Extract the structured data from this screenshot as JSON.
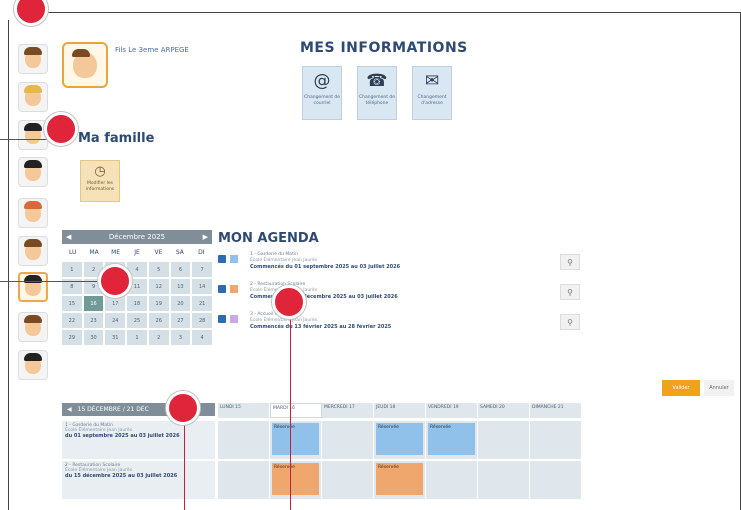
{
  "user": {
    "name": "Fils Le 3eme ARPEGE"
  },
  "mes_informations": {
    "title": "MES INFORMATIONS",
    "tiles": [
      {
        "icon": "at-icon",
        "label": "Changement de courriel"
      },
      {
        "icon": "phone-icon",
        "label": "Changement de téléphone"
      },
      {
        "icon": "envelope-icon",
        "label": "Changement d'adresse"
      }
    ]
  },
  "famille": {
    "title": "Ma famille",
    "tile_label": "Modifier les informations"
  },
  "calendar": {
    "month": "Décembre 2025",
    "days": [
      "LU",
      "MA",
      "ME",
      "JE",
      "VE",
      "SA",
      "DI"
    ],
    "cells": [
      "1",
      "2",
      "3",
      "4",
      "5",
      "6",
      "7",
      "8",
      "9",
      "10",
      "11",
      "12",
      "13",
      "14",
      "15",
      "16",
      "17",
      "18",
      "19",
      "20",
      "21",
      "22",
      "23",
      "24",
      "25",
      "26",
      "27",
      "28",
      "29",
      "30",
      "31",
      "1",
      "2",
      "3",
      "4"
    ],
    "today_index": 15
  },
  "agenda": {
    "title": "MON AGENDA",
    "items": [
      {
        "color": "#8fc1ea",
        "l1": "1 - Garderie du Matin",
        "l2": "École Élémentaire Jean Jaurès",
        "l3": "Commencés du 01 septembre 2025 au 03 juillet 2026"
      },
      {
        "color": "#efa76d",
        "l1": "2 - Restauration Scolaire",
        "l2": "École Élémentaire Jean Jaurès",
        "l3": "Commencés du 15 décembre 2025 au 03 juillet 2026"
      },
      {
        "color": "#c9a9e6",
        "l1": "3 - Accueil Périscolaire",
        "l2": "École Élémentaire Jean Jaurès",
        "l3": "Commencés du 13 février 2025 au 28 février 2025"
      }
    ]
  },
  "buttons": {
    "primary": "Valider",
    "secondary": "Annuler"
  },
  "week": {
    "label": "15 DÉCEMBRE / 21 DÉC",
    "days": [
      "LUNDI 15",
      "MARDI 16",
      "MERCREDI 17",
      "JEUDI 18",
      "VENDREDI 19",
      "SAMEDI 20",
      "DIMANCHE 21"
    ],
    "current_day_index": 1,
    "rows": [
      {
        "a": "1 - Garderie du Matin",
        "b": "École Élémentaire Jean Jaurès",
        "c": "du 01 septembre 2025 au 03 juillet 2026",
        "color": "blue",
        "event": "Réservée",
        "days": [
          1,
          3,
          4
        ]
      },
      {
        "a": "2 - Restauration Scolaire",
        "b": "École Élémentaire Jean Jaurès",
        "c": "du 15 décembre 2025 au 03 juillet 2026",
        "color": "orange",
        "event": "Réservée",
        "days": [
          1,
          3
        ]
      }
    ]
  },
  "colors": {
    "accent": "#f0a21b",
    "title": "#2e4a72",
    "marker": "#e0243a"
  }
}
